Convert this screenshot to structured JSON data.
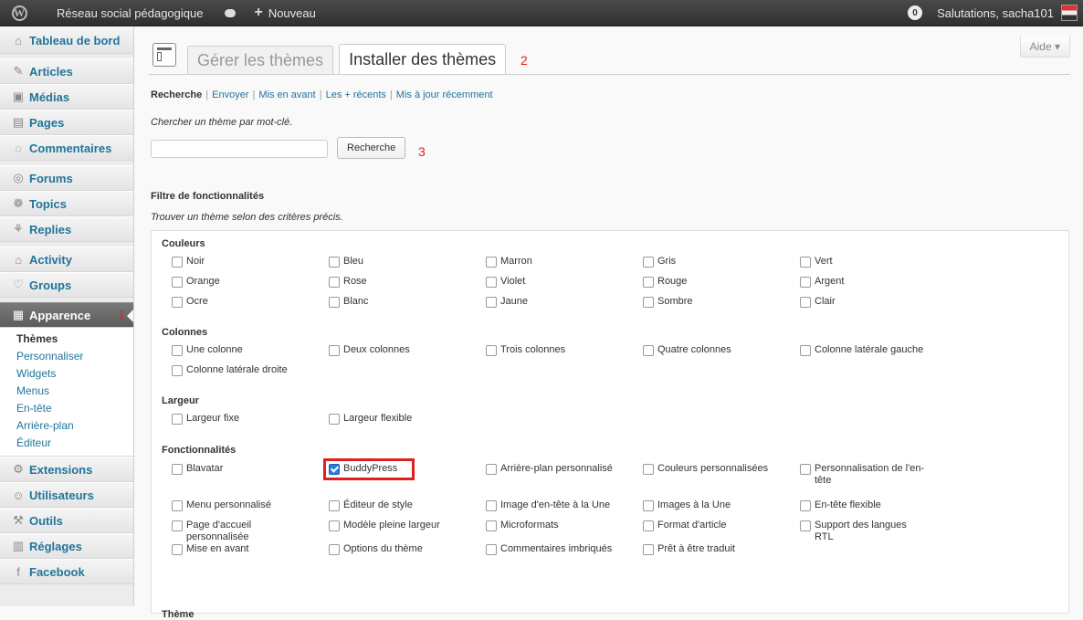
{
  "adminbar": {
    "site_name": "Réseau social pédagogique",
    "new_label": "Nouveau",
    "notification_count": "0",
    "greeting": "Salutations, sacha101"
  },
  "sidebar": {
    "items": [
      {
        "label": "Tableau de bord",
        "icon": "home-icon",
        "glyph": "⌂"
      },
      {
        "label": "Articles",
        "icon": "pushpin-icon",
        "glyph": "✎"
      },
      {
        "label": "Médias",
        "icon": "media-icon",
        "glyph": "▣"
      },
      {
        "label": "Pages",
        "icon": "page-icon",
        "glyph": "▤"
      },
      {
        "label": "Commentaires",
        "icon": "comment-icon",
        "glyph": "◌"
      },
      {
        "label": "Forums",
        "icon": "forum-icon",
        "glyph": "◎"
      },
      {
        "label": "Topics",
        "icon": "topics-icon",
        "glyph": "❁"
      },
      {
        "label": "Replies",
        "icon": "replies-icon",
        "glyph": "⚘"
      },
      {
        "label": "Activity",
        "icon": "activity-icon",
        "glyph": "⌂"
      },
      {
        "label": "Groups",
        "icon": "groups-icon",
        "glyph": "♡"
      },
      {
        "label": "Apparence",
        "icon": "appearance-icon",
        "glyph": "▦",
        "annotation": "1"
      },
      {
        "label": "Extensions",
        "icon": "plugin-icon",
        "glyph": "⚙"
      },
      {
        "label": "Utilisateurs",
        "icon": "users-icon",
        "glyph": "☺"
      },
      {
        "label": "Outils",
        "icon": "tools-icon",
        "glyph": "⚒"
      },
      {
        "label": "Réglages",
        "icon": "settings-icon",
        "glyph": "▥"
      },
      {
        "label": "Facebook",
        "icon": "facebook-icon",
        "glyph": "f"
      }
    ],
    "submenu": [
      "Thèmes",
      "Personnaliser",
      "Widgets",
      "Menus",
      "En-tête",
      "Arrière-plan",
      "Éditeur"
    ]
  },
  "help_label": "Aide",
  "tabs": {
    "manage": "Gérer les thèmes",
    "install": "Installer des thèmes",
    "annotation": "2"
  },
  "subnav": [
    "Recherche",
    "Envoyer",
    "Mis en avant",
    "Les + récents",
    "Mis à jour récemment"
  ],
  "search": {
    "hint": "Chercher un thème par mot-clé.",
    "value": "",
    "button": "Recherche",
    "annotation": "3"
  },
  "filter": {
    "heading": "Filtre de fonctionnalités",
    "hint": "Trouver un thème selon des critères précis.",
    "groups": [
      {
        "title": "Couleurs",
        "items": [
          "Noir",
          "Bleu",
          "Marron",
          "Gris",
          "Vert",
          "Orange",
          "Rose",
          "Violet",
          "Rouge",
          "Argent",
          "Ocre",
          "Blanc",
          "Jaune",
          "Sombre",
          "Clair"
        ]
      },
      {
        "title": "Colonnes",
        "items": [
          "Une colonne",
          "Deux colonnes",
          "Trois colonnes",
          "Quatre colonnes",
          "Colonne latérale gauche",
          "Colonne latérale droite"
        ]
      },
      {
        "title": "Largeur",
        "items": [
          "Largeur fixe",
          "Largeur flexible"
        ]
      },
      {
        "title": "Fonctionnalités",
        "items": [
          "Blavatar",
          "BuddyPress",
          "Arrière-plan personnalisé",
          "Couleurs personnalisées",
          "Personnalisation de l'en-tête",
          "Menu personnalisé",
          "Éditeur de style",
          "Image d'en-tête à la Une",
          "Images à la Une",
          "En-tête flexible",
          "Page d'accueil personnalisée",
          "Modèle pleine largeur",
          "Microformats",
          "Format d'article",
          "Support des langues RTL",
          "Mise en avant",
          "Options du thème",
          "Commentaires imbriqués",
          "Prêt à être traduit"
        ],
        "checked": [
          "BuddyPress"
        ]
      },
      {
        "title": "Thème",
        "items": []
      }
    ]
  }
}
